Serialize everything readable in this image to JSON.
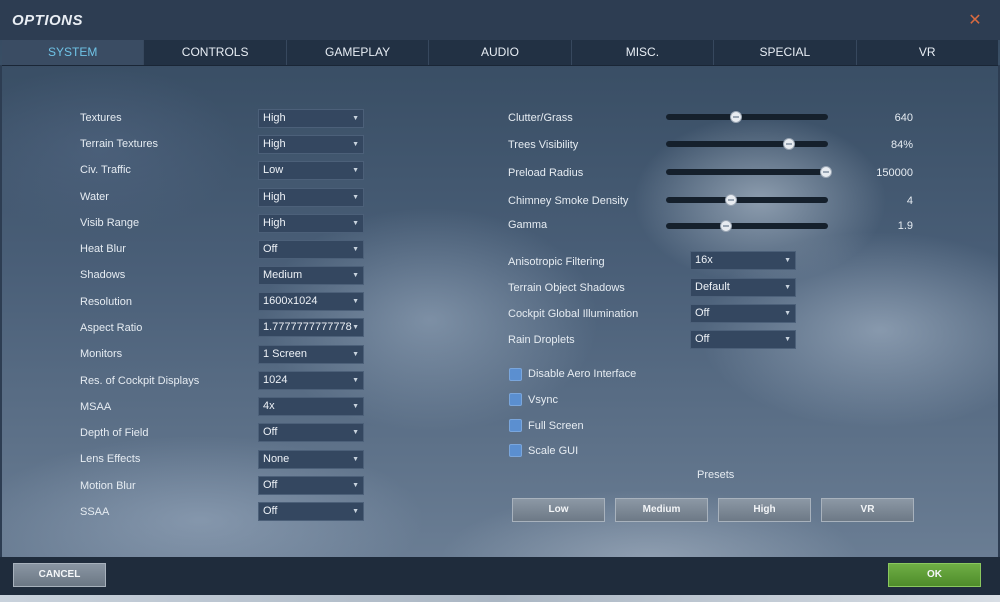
{
  "window": {
    "title": "OPTIONS"
  },
  "tabs": [
    "SYSTEM",
    "CONTROLS",
    "GAMEPLAY",
    "AUDIO",
    "MISC.",
    "SPECIAL",
    "VR"
  ],
  "active_tab": "SYSTEM",
  "left_settings": [
    {
      "label": "Textures",
      "value": "High"
    },
    {
      "label": "Terrain Textures",
      "value": "High"
    },
    {
      "label": "Civ. Traffic",
      "value": "Low"
    },
    {
      "label": "Water",
      "value": "High"
    },
    {
      "label": "Visib Range",
      "value": "High"
    },
    {
      "label": "Heat Blur",
      "value": "Off"
    },
    {
      "label": "Shadows",
      "value": "Medium"
    },
    {
      "label": "Resolution",
      "value": "1600x1024"
    },
    {
      "label": "Aspect Ratio",
      "value": "1.7777777777778"
    },
    {
      "label": "Monitors",
      "value": "1 Screen"
    },
    {
      "label": "Res. of Cockpit Displays",
      "value": "1024"
    },
    {
      "label": "MSAA",
      "value": "4x"
    },
    {
      "label": "Depth of Field",
      "value": "Off"
    },
    {
      "label": "Lens Effects",
      "value": "None"
    },
    {
      "label": "Motion Blur",
      "value": "Off"
    },
    {
      "label": "SSAA",
      "value": "Off"
    }
  ],
  "sliders": [
    {
      "label": "Clutter/Grass",
      "value": "640",
      "fraction": 0.43
    },
    {
      "label": "Trees Visibility",
      "value": "84%",
      "fraction": 0.76
    },
    {
      "label": "Preload Radius",
      "value": "150000",
      "fraction": 1.0
    },
    {
      "label": "Chimney Smoke Density",
      "value": "4",
      "fraction": 0.4
    },
    {
      "label": "Gamma",
      "value": "1.9",
      "fraction": 0.37
    }
  ],
  "right_settings": [
    {
      "label": "Anisotropic Filtering",
      "value": "16x"
    },
    {
      "label": "Terrain Object Shadows",
      "value": "Default"
    },
    {
      "label": "Cockpit Global Illumination",
      "value": "Off"
    },
    {
      "label": "Rain Droplets",
      "value": "Off"
    }
  ],
  "checkboxes": [
    {
      "label": "Disable Aero Interface"
    },
    {
      "label": "Vsync"
    },
    {
      "label": "Full Screen"
    },
    {
      "label": "Scale GUI"
    }
  ],
  "presets": {
    "title": "Presets",
    "buttons": [
      "Low",
      "Medium",
      "High",
      "VR"
    ]
  },
  "footer": {
    "cancel_label": "CANCEL",
    "ok_label": "OK"
  },
  "colors": {
    "active_tab_text": "#6fc3e6",
    "ok_button": "#5f9e36",
    "close_icon": "#d86a40"
  }
}
